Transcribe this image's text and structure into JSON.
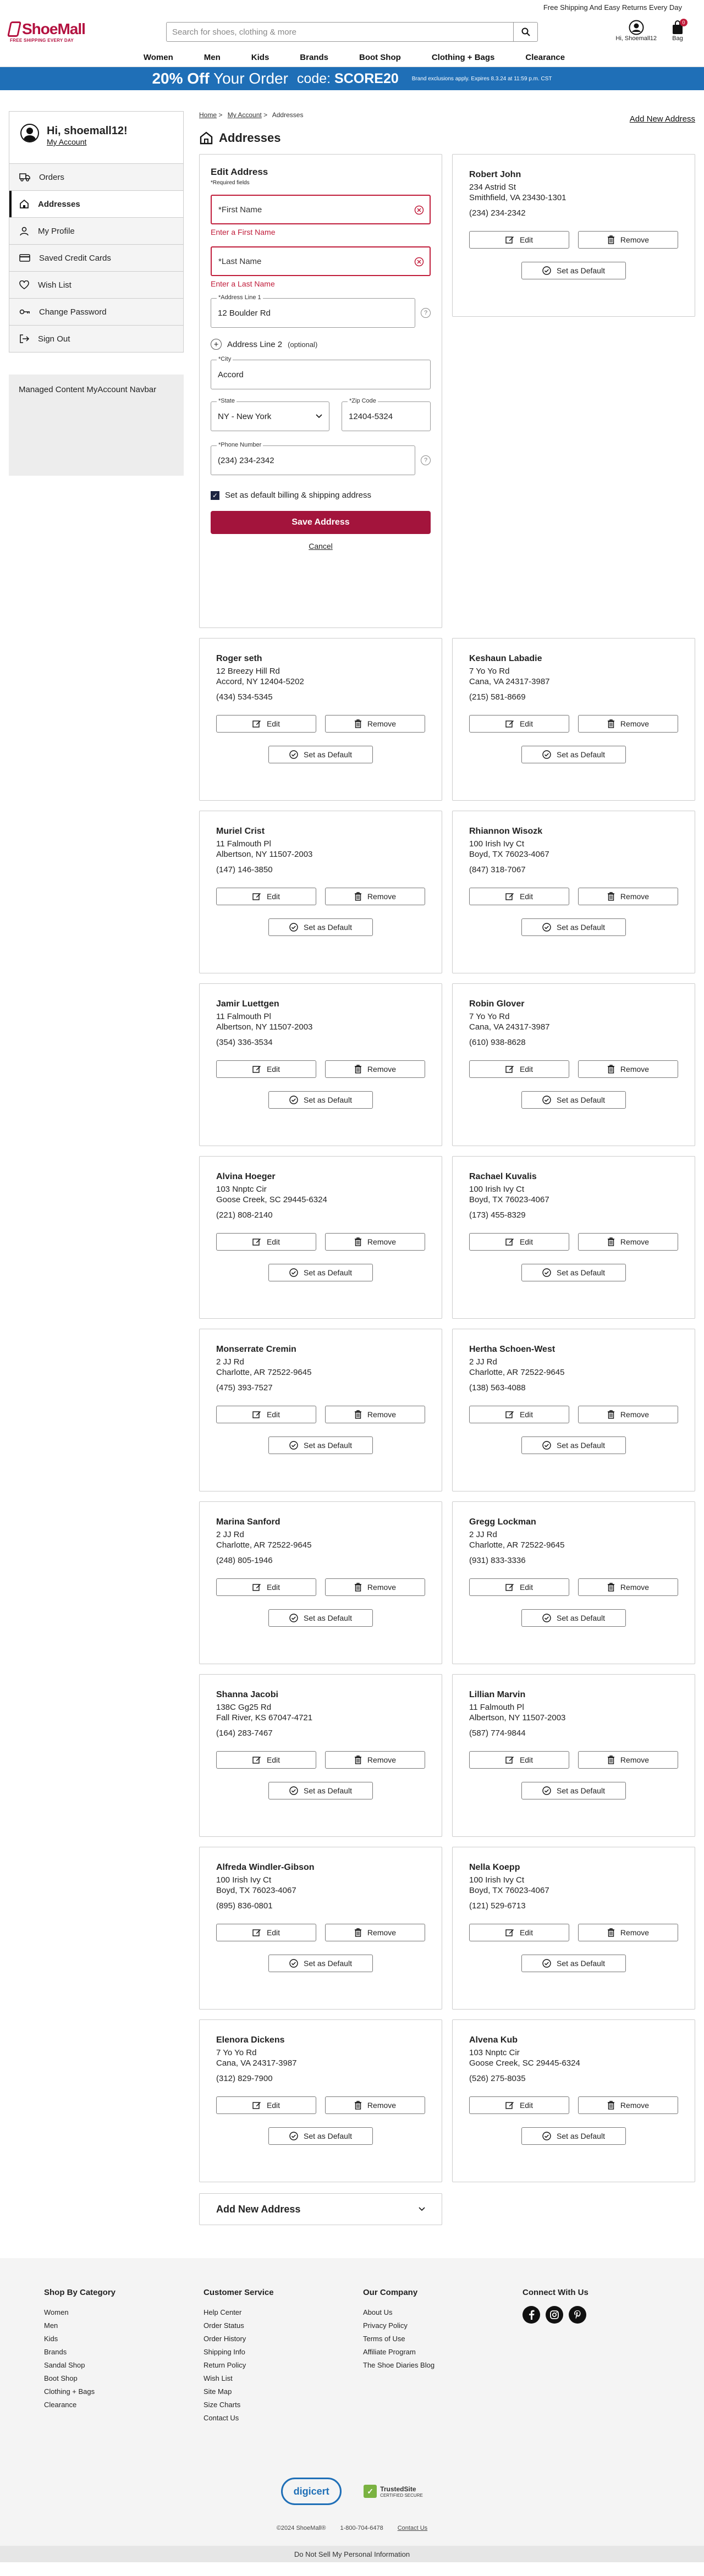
{
  "topbar": {
    "text": "Free Shipping And Easy Returns Every Day"
  },
  "brand": {
    "name": "ShoeMall",
    "tagline": "FREE SHIPPING EVERY DAY",
    "color": "#b3113f"
  },
  "search": {
    "placeholder": "Search for shoes, clothing & more"
  },
  "header": {
    "user_label": "Hi, Shoemall12",
    "bag_label": "Bag",
    "bag_count": "0"
  },
  "nav": [
    "Women",
    "Men",
    "Kids",
    "Brands",
    "Boot Shop",
    "Clothing + Bags",
    "Clearance"
  ],
  "promo": {
    "off": "20% Off",
    "order": "Your Order",
    "code_label": "code:",
    "code": "SCORE20",
    "fine": "Brand exclusions apply. Expires 8.3.24 at 11:59 p.m. CST",
    "color": "#1f6fb7"
  },
  "sidebar": {
    "greeting": "Hi, shoemall12!",
    "my_account": "My Account",
    "items": [
      {
        "label": "Orders",
        "icon": "truck-icon"
      },
      {
        "label": "Addresses",
        "icon": "home-icon"
      },
      {
        "label": "My Profile",
        "icon": "user-icon"
      },
      {
        "label": "Saved Credit Cards",
        "icon": "credit-card-icon"
      },
      {
        "label": "Wish List",
        "icon": "heart-icon"
      },
      {
        "label": "Change Password",
        "icon": "key-icon"
      },
      {
        "label": "Sign Out",
        "icon": "sign-out-icon"
      }
    ],
    "managed": "Managed Content MyAccount Navbar"
  },
  "breadcrumb": [
    "Home",
    "My Account",
    "Addresses"
  ],
  "page": {
    "title": "Addresses",
    "add_new": "Add New Address"
  },
  "edit": {
    "title": "Edit Address",
    "required": "*Required fields",
    "first_name_ph": "*First Name",
    "first_name_err": "Enter a First Name",
    "last_name_ph": "*Last Name",
    "last_name_err": "Enter a Last Name",
    "addr1_label": "*Address Line 1",
    "addr1": "12 Boulder Rd",
    "addr2_label": "Address Line 2",
    "addr2_opt": "(optional)",
    "city_label": "*City",
    "city": "Accord",
    "state_label": "*State",
    "state": "NY - New York",
    "zip_label": "*Zip Code",
    "zip": "12404-5324",
    "phone_label": "*Phone Number",
    "phone": "(234) 234-2342",
    "default_label": "Set as default billing & shipping address",
    "save": "Save Address",
    "cancel": "Cancel"
  },
  "buttons": {
    "edit": "Edit",
    "remove": "Remove",
    "default": "Set as Default"
  },
  "addresses": [
    {
      "name": "Robert John",
      "street": "234 Astrid St",
      "city": "Smithfield, VA 23430-1301",
      "phone": "(234) 234-2342"
    },
    {
      "name": "Roger seth",
      "street": "12 Breezy Hill Rd",
      "city": "Accord, NY 12404-5202",
      "phone": "(434) 534-5345"
    },
    {
      "name": "Keshaun Labadie",
      "street": "7 Yo Yo Rd",
      "city": "Cana, VA 24317-3987",
      "phone": "(215) 581-8669"
    },
    {
      "name": "Muriel Crist",
      "street": "11 Falmouth Pl",
      "city": "Albertson, NY 11507-2003",
      "phone": "(147) 146-3850"
    },
    {
      "name": "Rhiannon Wisozk",
      "street": "100 Irish Ivy Ct",
      "city": "Boyd, TX 76023-4067",
      "phone": "(847) 318-7067"
    },
    {
      "name": "Jamir Luettgen",
      "street": "11 Falmouth Pl",
      "city": "Albertson, NY 11507-2003",
      "phone": "(354) 336-3534"
    },
    {
      "name": "Robin Glover",
      "street": "7 Yo Yo Rd",
      "city": "Cana, VA 24317-3987",
      "phone": "(610) 938-8628"
    },
    {
      "name": "Alvina Hoeger",
      "street": "103 Nnptc Cir",
      "city": "Goose Creek, SC 29445-6324",
      "phone": "(221) 808-2140"
    },
    {
      "name": "Rachael Kuvalis",
      "street": "100 Irish Ivy Ct",
      "city": "Boyd, TX 76023-4067",
      "phone": "(173) 455-8329"
    },
    {
      "name": "Monserrate Cremin",
      "street": "2 JJ Rd",
      "city": "Charlotte, AR 72522-9645",
      "phone": "(475) 393-7527"
    },
    {
      "name": "Hertha Schoen-West",
      "street": "2 JJ Rd",
      "city": "Charlotte, AR 72522-9645",
      "phone": "(138) 563-4088"
    },
    {
      "name": "Marina Sanford",
      "street": "2 JJ Rd",
      "city": "Charlotte, AR 72522-9645",
      "phone": "(248) 805-1946"
    },
    {
      "name": "Gregg Lockman",
      "street": "2 JJ Rd",
      "city": "Charlotte, AR 72522-9645",
      "phone": "(931) 833-3336"
    },
    {
      "name": "Shanna Jacobi",
      "street": "138C Gg25 Rd",
      "city": "Fall River, KS 67047-4721",
      "phone": "(164) 283-7467"
    },
    {
      "name": "Lillian Marvin",
      "street": "11 Falmouth Pl",
      "city": "Albertson, NY 11507-2003",
      "phone": "(587) 774-9844"
    },
    {
      "name": "Alfreda Windler-Gibson",
      "street": "100 Irish Ivy Ct",
      "city": "Boyd, TX 76023-4067",
      "phone": "(895) 836-0801"
    },
    {
      "name": "Nella Koepp",
      "street": "100 Irish Ivy Ct",
      "city": "Boyd, TX 76023-4067",
      "phone": "(121) 529-6713"
    },
    {
      "name": "Elenora Dickens",
      "street": "7 Yo Yo Rd",
      "city": "Cana, VA 24317-3987",
      "phone": "(312) 829-7900"
    },
    {
      "name": "Alvena Kub",
      "street": "103 Nnptc Cir",
      "city": "Goose Creek, SC 29445-6324",
      "phone": "(526) 275-8035"
    }
  ],
  "add_bar": "Add New Address",
  "footer": {
    "cols": [
      {
        "title": "Shop By Category",
        "links": [
          "Women",
          "Men",
          "Kids",
          "Brands",
          "Sandal Shop",
          "Boot Shop",
          "Clothing + Bags",
          "Clearance"
        ]
      },
      {
        "title": "Customer Service",
        "links": [
          "Help Center",
          "Order Status",
          "Order History",
          "Shipping Info",
          "Return Policy",
          "Wish List",
          "Site Map",
          "Size Charts",
          "Contact Us"
        ]
      },
      {
        "title": "Our Company",
        "links": [
          "About Us",
          "Privacy Policy",
          "Terms of Use",
          "Affiliate Program",
          "The Shoe Diaries Blog"
        ]
      },
      {
        "title": "Connect With Us",
        "links": []
      }
    ],
    "digicert": "digicert",
    "trusted": "TrustedSite",
    "trusted_sub": "CERTIFIED SECURE",
    "copyright": "©2024 ShoeMall®",
    "phone": "1-800-704-6478",
    "contact": "Contact Us",
    "dns": "Do Not Sell My Personal Information"
  }
}
